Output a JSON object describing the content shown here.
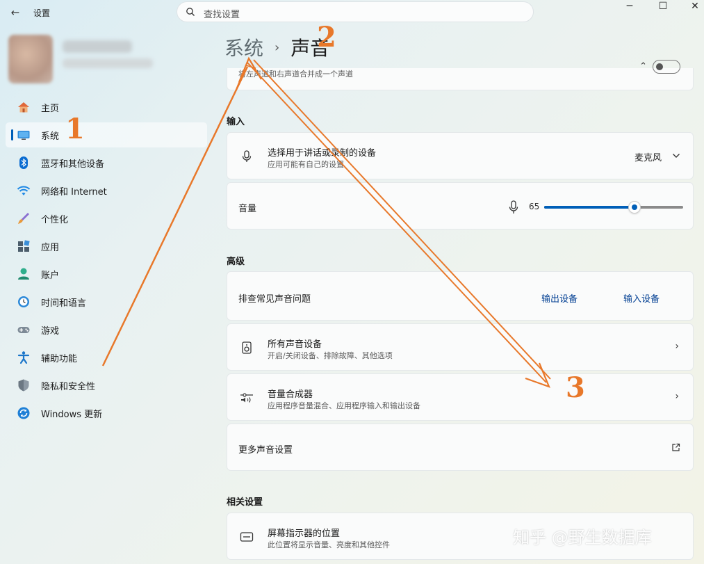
{
  "window": {
    "app_title": "设置",
    "back_icon": "back-arrow-icon",
    "controls": {
      "minimize": "─",
      "maximize": "☐",
      "close": "✕"
    }
  },
  "search": {
    "placeholder": "查找设置"
  },
  "sidebar": {
    "items": [
      {
        "label": "主页",
        "icon": "home-icon"
      },
      {
        "label": "系统",
        "icon": "system-icon",
        "active": true
      },
      {
        "label": "蓝牙和其他设备",
        "icon": "bluetooth-icon"
      },
      {
        "label": "网络和 Internet",
        "icon": "wifi-icon"
      },
      {
        "label": "个性化",
        "icon": "brush-icon"
      },
      {
        "label": "应用",
        "icon": "apps-icon"
      },
      {
        "label": "账户",
        "icon": "account-icon"
      },
      {
        "label": "时间和语言",
        "icon": "clock-globe-icon"
      },
      {
        "label": "游戏",
        "icon": "gamepad-icon"
      },
      {
        "label": "辅助功能",
        "icon": "accessibility-icon"
      },
      {
        "label": "隐私和安全性",
        "icon": "shield-icon"
      },
      {
        "label": "Windows 更新",
        "icon": "update-icon"
      }
    ]
  },
  "breadcrumb": {
    "parent": "系统",
    "separator": "›",
    "current": "声音"
  },
  "mono_row": {
    "text": "将左声道和右声道合并成一个声道"
  },
  "input_section": {
    "heading": "输入",
    "device_row": {
      "title": "选择用于讲话或录制的设备",
      "subtitle": "应用可能有自己的设置",
      "value": "麦克风"
    },
    "volume_row": {
      "title": "音量",
      "value": "65",
      "level": 0.65
    }
  },
  "advanced_section": {
    "heading": "高级",
    "troubleshoot_row": {
      "title": "排查常见声音问题",
      "output_link": "输出设备",
      "input_link": "输入设备"
    },
    "all_devices_row": {
      "title": "所有声音设备",
      "subtitle": "开启/关闭设备、排除故障、其他选项"
    },
    "mixer_row": {
      "title": "音量合成器",
      "subtitle": "应用程序音量混合、应用程序输入和输出设备"
    },
    "more_row": {
      "title": "更多声音设置"
    }
  },
  "related_section": {
    "heading": "相关设置",
    "indicator_row": {
      "title": "屏幕指示器的位置",
      "subtitle": "此位置将显示音量、亮度和其他控件"
    }
  },
  "annotations": {
    "one": "1",
    "two": "2",
    "three": "3"
  },
  "watermark": "知乎 @野生数据库",
  "colors": {
    "accent": "#005fb8",
    "annotation": "#e8782a",
    "link": "#003e92"
  }
}
